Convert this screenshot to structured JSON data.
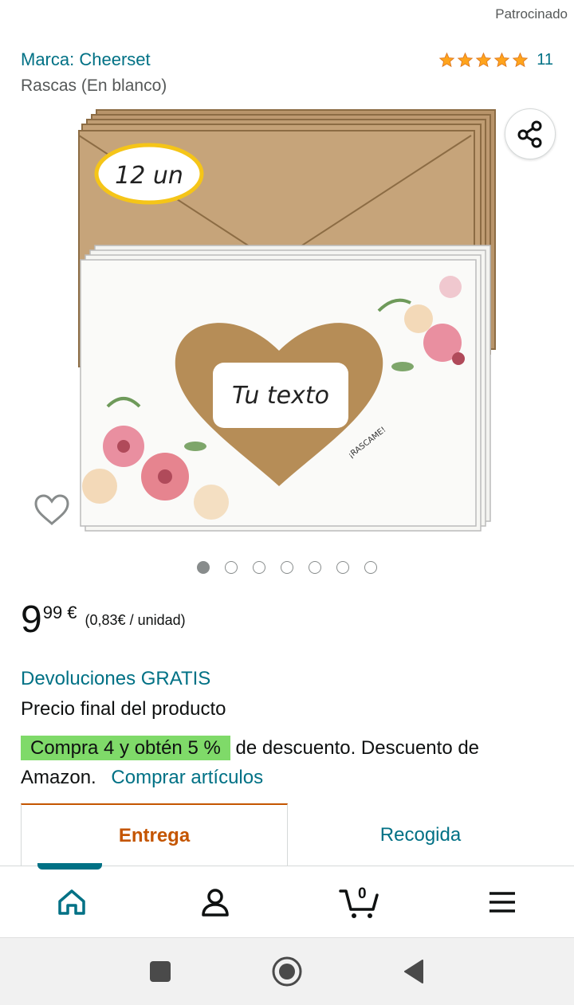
{
  "sponsored_label": "Patrocinado",
  "product": {
    "brand": "Marca: Cheerset",
    "rating_count": "11",
    "format": "Rascas (En blanco)",
    "image_badge": "12 un",
    "image_heart_text": "Tu texto",
    "image_scratch_text": "¡RASCAME!",
    "carousel_total": 7,
    "carousel_active": 1
  },
  "price": {
    "whole": "9",
    "fraction": "99 €",
    "unit": "(0,83€ / unidad)"
  },
  "returns": "Devoluciones GRATIS",
  "final_price_note": "Precio final del producto",
  "promo": {
    "badge": "Compra 4 y obtén 5 %",
    "text": "de descuento. Descuento de Amazon.",
    "link": "Comprar artículos"
  },
  "tabs": [
    {
      "label": "Entrega"
    },
    {
      "label": "Recogida"
    }
  ],
  "nav": {
    "cart_count": "0",
    "icons": [
      "home-icon",
      "account-icon",
      "cart-icon",
      "menu-icon"
    ]
  },
  "colors": {
    "link": "#007185",
    "star": "#ffa41c",
    "promo_green": "#7fda69",
    "active_tab": "#c45500"
  }
}
